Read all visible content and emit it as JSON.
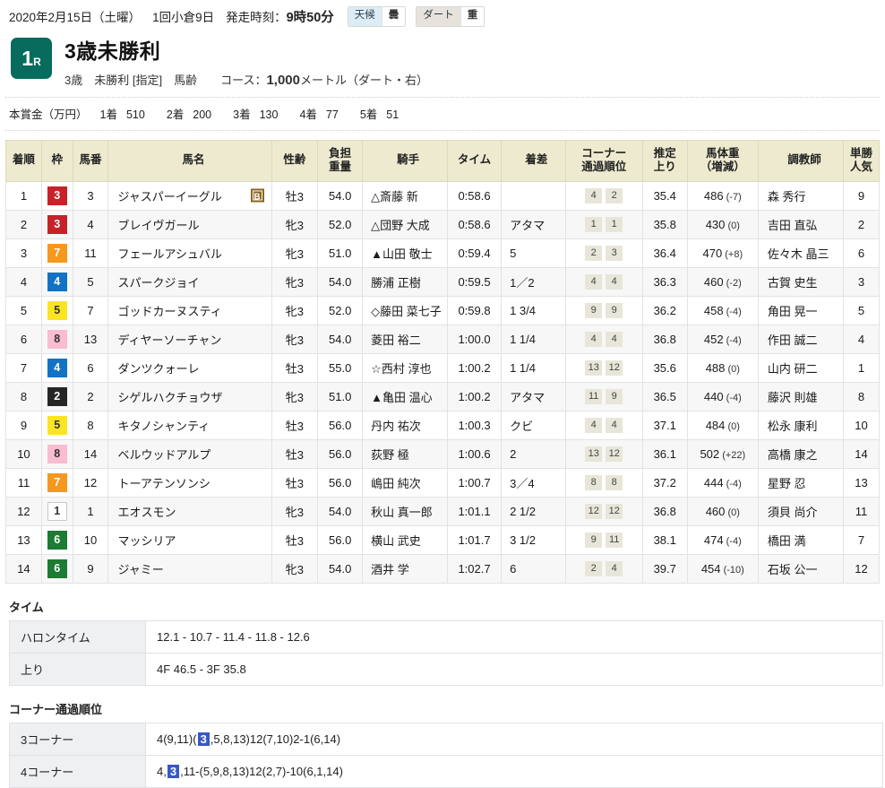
{
  "header": {
    "date": "2020年2月15日（土曜）",
    "meeting": "1回小倉9日",
    "post_time_label": "発走時刻：",
    "post_time": "9時50分",
    "weather_label": "天候",
    "weather_value": "曇",
    "surface_label": "ダート",
    "track_condition": "重"
  },
  "race": {
    "number": "1",
    "number_suffix": "R",
    "badge_color": "#076b5d",
    "title": "3歳未勝利",
    "conditions_age": "3歳",
    "conditions_class": "未勝利 [指定]",
    "conditions_weight": "馬齢",
    "course_label": "コース：",
    "course_distance": "1,000",
    "course_unit": "メートル",
    "course_detail": "（ダート・右）"
  },
  "prize": {
    "label": "本賞金（万円）",
    "entries": [
      {
        "place": "1着",
        "amount": "510"
      },
      {
        "place": "2着",
        "amount": "200"
      },
      {
        "place": "3着",
        "amount": "130"
      },
      {
        "place": "4着",
        "amount": "77"
      },
      {
        "place": "5着",
        "amount": "51"
      }
    ]
  },
  "table": {
    "columns": [
      "着順",
      "枠",
      "馬番",
      "馬名",
      "性齢",
      "負担重量",
      "騎手",
      "タイム",
      "着差",
      "コーナー通過順位",
      "推定上り",
      "馬体重（増減）",
      "調教師",
      "単勝人気"
    ],
    "columns_multiline": {
      "kin": [
        "負担",
        "重量"
      ],
      "corner": [
        "コーナー",
        "通過順位"
      ],
      "agari": [
        "推定",
        "上り"
      ],
      "weight": [
        "馬体重",
        "（増減）"
      ],
      "pop": [
        "単勝",
        "人気"
      ]
    },
    "rows": [
      {
        "rank": "1",
        "waku": "3",
        "umaban": "3",
        "name": "ジャスパーイーグル",
        "mark": "B",
        "sex": "牡3",
        "kin": "54.0",
        "jockey": "△斎藤 新",
        "time": "0:58.6",
        "diff": "",
        "corners": [
          "4",
          "2"
        ],
        "agari": "35.4",
        "weight": "486",
        "delta": "(-7)",
        "trainer": "森 秀行",
        "pop": "9"
      },
      {
        "rank": "2",
        "waku": "3",
        "umaban": "4",
        "name": "ブレイヴガール",
        "mark": "",
        "sex": "牝3",
        "kin": "52.0",
        "jockey": "△団野 大成",
        "time": "0:58.6",
        "diff": "アタマ",
        "corners": [
          "1",
          "1"
        ],
        "agari": "35.8",
        "weight": "430",
        "delta": "(0)",
        "trainer": "吉田 直弘",
        "pop": "2"
      },
      {
        "rank": "3",
        "waku": "7",
        "umaban": "11",
        "name": "フェールアシュバル",
        "mark": "",
        "sex": "牝3",
        "kin": "51.0",
        "jockey": "▲山田 敬士",
        "time": "0:59.4",
        "diff": "5",
        "corners": [
          "2",
          "3"
        ],
        "agari": "36.4",
        "weight": "470",
        "delta": "(+8)",
        "trainer": "佐々木 晶三",
        "pop": "6"
      },
      {
        "rank": "4",
        "waku": "4",
        "umaban": "5",
        "name": "スパークジョイ",
        "mark": "",
        "sex": "牝3",
        "kin": "54.0",
        "jockey": "勝浦 正樹",
        "time": "0:59.5",
        "diff": "1／2",
        "corners": [
          "4",
          "4"
        ],
        "agari": "36.3",
        "weight": "460",
        "delta": "(-2)",
        "trainer": "古賀 史生",
        "pop": "3"
      },
      {
        "rank": "5",
        "waku": "5",
        "umaban": "7",
        "name": "ゴッドカーヌスティ",
        "mark": "",
        "sex": "牝3",
        "kin": "52.0",
        "jockey": "◇藤田 菜七子",
        "time": "0:59.8",
        "diff": "1 3/4",
        "corners": [
          "9",
          "9"
        ],
        "agari": "36.2",
        "weight": "458",
        "delta": "(-4)",
        "trainer": "角田 晃一",
        "pop": "5"
      },
      {
        "rank": "6",
        "waku": "8",
        "umaban": "13",
        "name": "ディヤーソーチャン",
        "mark": "",
        "sex": "牝3",
        "kin": "54.0",
        "jockey": "菱田 裕二",
        "time": "1:00.0",
        "diff": "1 1/4",
        "corners": [
          "4",
          "4"
        ],
        "agari": "36.8",
        "weight": "452",
        "delta": "(-4)",
        "trainer": "作田 誠二",
        "pop": "4"
      },
      {
        "rank": "7",
        "waku": "4",
        "umaban": "6",
        "name": "ダンツクォーレ",
        "mark": "",
        "sex": "牡3",
        "kin": "55.0",
        "jockey": "☆西村 淳也",
        "time": "1:00.2",
        "diff": "1 1/4",
        "corners": [
          "13",
          "12"
        ],
        "agari": "35.6",
        "weight": "488",
        "delta": "(0)",
        "trainer": "山内 研二",
        "pop": "1"
      },
      {
        "rank": "8",
        "waku": "2",
        "umaban": "2",
        "name": "シゲルハクチョウザ",
        "mark": "",
        "sex": "牝3",
        "kin": "51.0",
        "jockey": "▲亀田 温心",
        "time": "1:00.2",
        "diff": "アタマ",
        "corners": [
          "11",
          "9"
        ],
        "agari": "36.5",
        "weight": "440",
        "delta": "(-4)",
        "trainer": "藤沢 則雄",
        "pop": "8"
      },
      {
        "rank": "9",
        "waku": "5",
        "umaban": "8",
        "name": "キタノシャンティ",
        "mark": "",
        "sex": "牡3",
        "kin": "56.0",
        "jockey": "丹内 祐次",
        "time": "1:00.3",
        "diff": "クビ",
        "corners": [
          "4",
          "4"
        ],
        "agari": "37.1",
        "weight": "484",
        "delta": "(0)",
        "trainer": "松永 康利",
        "pop": "10"
      },
      {
        "rank": "10",
        "waku": "8",
        "umaban": "14",
        "name": "ベルウッドアルプ",
        "mark": "",
        "sex": "牡3",
        "kin": "56.0",
        "jockey": "荻野 極",
        "time": "1:00.6",
        "diff": "2",
        "corners": [
          "13",
          "12"
        ],
        "agari": "36.1",
        "weight": "502",
        "delta": "(+22)",
        "trainer": "高橋 康之",
        "pop": "14"
      },
      {
        "rank": "11",
        "waku": "7",
        "umaban": "12",
        "name": "トーアテンソンシ",
        "mark": "",
        "sex": "牡3",
        "kin": "56.0",
        "jockey": "嶋田 純次",
        "time": "1:00.7",
        "diff": "3／4",
        "corners": [
          "8",
          "8"
        ],
        "agari": "37.2",
        "weight": "444",
        "delta": "(-4)",
        "trainer": "星野 忍",
        "pop": "13"
      },
      {
        "rank": "12",
        "waku": "1",
        "umaban": "1",
        "name": "エオスモン",
        "mark": "",
        "sex": "牝3",
        "kin": "54.0",
        "jockey": "秋山 真一郎",
        "time": "1:01.1",
        "diff": "2 1/2",
        "corners": [
          "12",
          "12"
        ],
        "agari": "36.8",
        "weight": "460",
        "delta": "(0)",
        "trainer": "須貝 尚介",
        "pop": "11"
      },
      {
        "rank": "13",
        "waku": "6",
        "umaban": "10",
        "name": "マッシリア",
        "mark": "",
        "sex": "牡3",
        "kin": "56.0",
        "jockey": "横山 武史",
        "time": "1:01.7",
        "diff": "3 1/2",
        "corners": [
          "9",
          "11"
        ],
        "agari": "38.1",
        "weight": "474",
        "delta": "(-4)",
        "trainer": "橋田 満",
        "pop": "7"
      },
      {
        "rank": "14",
        "waku": "6",
        "umaban": "9",
        "name": "ジャミー",
        "mark": "",
        "sex": "牝3",
        "kin": "54.0",
        "jockey": "酒井 学",
        "time": "1:02.7",
        "diff": "6",
        "corners": [
          "2",
          "4"
        ],
        "agari": "39.7",
        "weight": "454",
        "delta": "(-10)",
        "trainer": "石坂 公一",
        "pop": "12"
      }
    ]
  },
  "time_section": {
    "title": "タイム",
    "rows": [
      {
        "label": "ハロンタイム",
        "value": "12.1 - 10.7 - 11.4 - 11.8 - 12.6"
      },
      {
        "label": "上り",
        "value": "4F 46.5 - 3F 35.8"
      }
    ]
  },
  "corner_section": {
    "title": "コーナー通過順位",
    "rows": [
      {
        "label": "3コーナー",
        "pre": "4(9,11)(",
        "hl": "3",
        "post": ",5,8,13)12(7,10)2-1(6,14)"
      },
      {
        "label": "4コーナー",
        "pre": "4,",
        "hl": "3",
        "post": ",11-(5,9,8,13)12(2,7)-10(6,1,14)"
      }
    ]
  },
  "colors": {
    "waku_1": "#ffffff",
    "waku_2": "#262626",
    "waku_3": "#c7222a",
    "waku_4": "#1273c6",
    "waku_5": "#fbe424",
    "waku_6": "#1d7b33",
    "waku_7": "#f6981e",
    "waku_8": "#f9bcd0",
    "header_bg": "#edeacf",
    "highlight": "#3758c5"
  }
}
